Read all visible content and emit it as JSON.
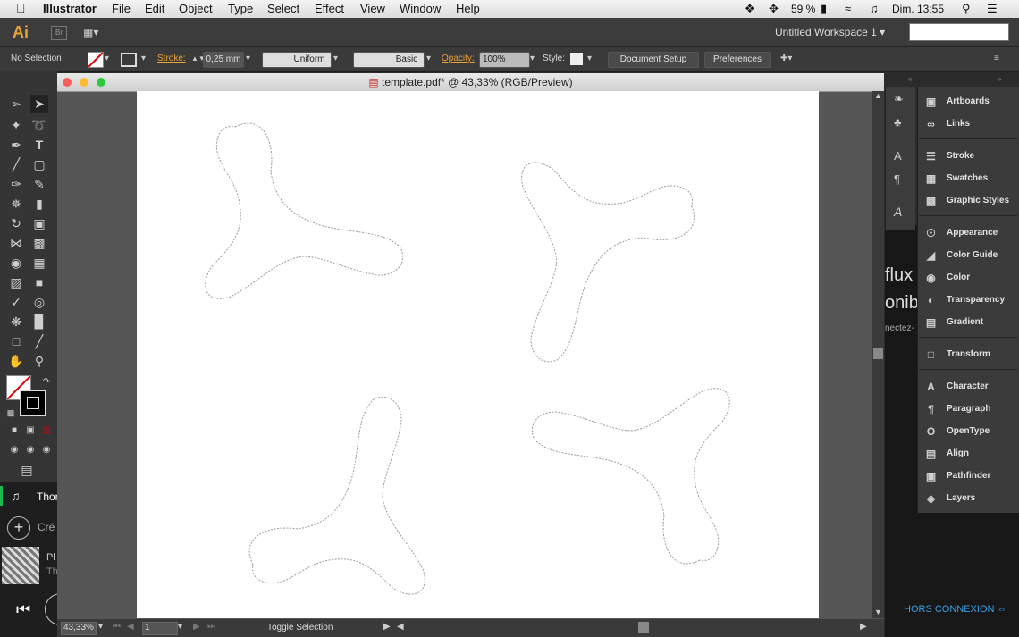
{
  "menubar": {
    "apple": "",
    "app": "Illustrator",
    "items": [
      "File",
      "Edit",
      "Object",
      "Type",
      "Select",
      "Effect",
      "View",
      "Window",
      "Help"
    ],
    "battery": "59 %",
    "clock": "Dim. 13:55"
  },
  "appbar": {
    "logo": "Ai",
    "br": "Br",
    "workspace": "Untitled Workspace 1"
  },
  "control": {
    "selection": "No Selection",
    "stroke_label": "Stroke:",
    "stroke_value": "0,25 mm",
    "profile": "Uniform",
    "brush": "Basic",
    "opacity_label": "Opacity:",
    "opacity_value": "100%",
    "style_label": "Style:",
    "doc_setup": "Document Setup",
    "preferences": "Preferences"
  },
  "document": {
    "title": "template.pdf* @ 43,33% (RGB/Preview)",
    "zoom": "43,33%",
    "artboard": "1",
    "status": "Toggle Selection"
  },
  "panels": [
    {
      "label": "Artboards",
      "icon": "artboards-icon"
    },
    {
      "label": "Links",
      "icon": "links-icon"
    },
    {
      "label": "Stroke",
      "icon": "stroke-icon"
    },
    {
      "label": "Swatches",
      "icon": "swatches-icon"
    },
    {
      "label": "Graphic Styles",
      "icon": "graphic-styles-icon"
    },
    {
      "label": "Appearance",
      "icon": "appearance-icon"
    },
    {
      "label": "Color Guide",
      "icon": "color-guide-icon"
    },
    {
      "label": "Color",
      "icon": "color-icon"
    },
    {
      "label": "Transparency",
      "icon": "transparency-icon"
    },
    {
      "label": "Gradient",
      "icon": "gradient-icon"
    },
    {
      "label": "Transform",
      "icon": "transform-icon"
    },
    {
      "label": "Character",
      "icon": "character-icon"
    },
    {
      "label": "Paragraph",
      "icon": "paragraph-icon"
    },
    {
      "label": "OpenType",
      "icon": "opentype-icon"
    },
    {
      "label": "Align",
      "icon": "align-icon"
    },
    {
      "label": "Pathfinder",
      "icon": "pathfinder-icon"
    },
    {
      "label": "Layers",
      "icon": "layers-icon"
    }
  ],
  "background_app": {
    "text1": "flux",
    "text2": "onib",
    "text3": "nectez-",
    "offline": "HORS CONNEXION",
    "music_left1": "Thor",
    "music_left2": "Cré",
    "music_left3": "Pl",
    "music_left4": "Th"
  }
}
